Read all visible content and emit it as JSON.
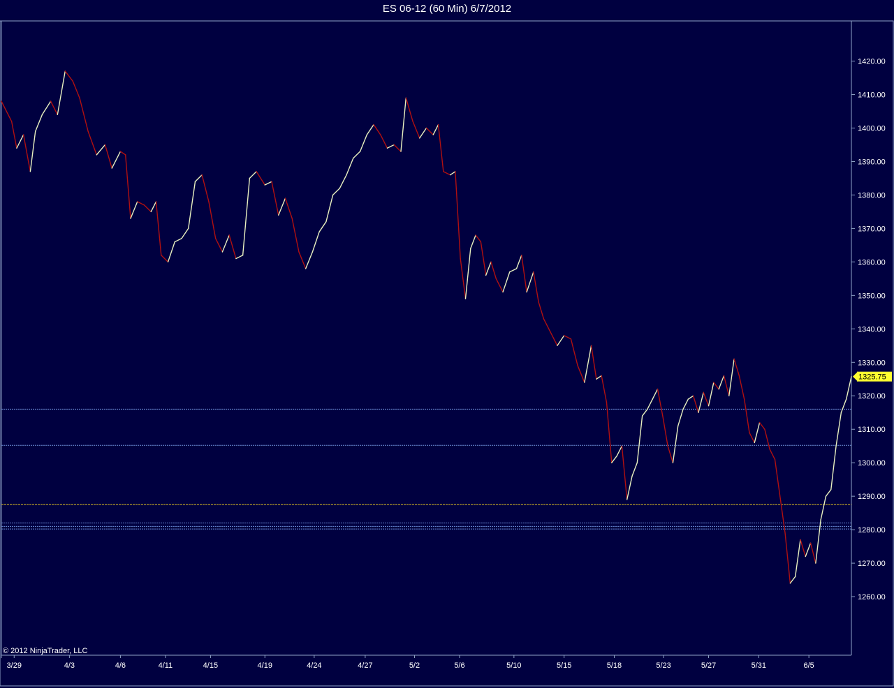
{
  "window": {
    "title": "ES 06-12 (60 Min)  6/7/2012"
  },
  "footer": {
    "copyright": "© 2012 NinjaTrader, LLC"
  },
  "colors": {
    "background": "#000040",
    "frame": "#8fa3c8",
    "text": "#ffffff",
    "up_line": "#e8f0c0",
    "down_line": "#b01010",
    "level_line_blue": "#6e8fd8",
    "level_line_yellow": "#e0c020",
    "price_marker": "#ffff30"
  },
  "chart_data": {
    "type": "line",
    "title": "ES 06-12 (60 Min)  6/7/2012",
    "instrument": "ES 06-12",
    "interval": "60 Min",
    "xlabel": "",
    "ylabel": "",
    "ylim": [
      1242.5,
      1432
    ],
    "y_ticks": [
      1420,
      1410,
      1400,
      1390,
      1380,
      1370,
      1360,
      1350,
      1340,
      1330,
      1320,
      1310,
      1300,
      1290,
      1280,
      1270,
      1260
    ],
    "y_tick_labels": [
      "1420.00",
      "1410.00",
      "1400.00",
      "1390.00",
      "1380.00",
      "1370.00",
      "1360.00",
      "1350.00",
      "1340.00",
      "1330.00",
      "1320.00",
      "1310.00",
      "1300.00",
      "1290.00",
      "1280.00",
      "1270.00",
      "1260.00"
    ],
    "x_ticks": [
      {
        "label": "3/29",
        "t": 0.015
      },
      {
        "label": "4/3",
        "t": 0.08
      },
      {
        "label": "4/6",
        "t": 0.14
      },
      {
        "label": "4/11",
        "t": 0.193
      },
      {
        "label": "4/15",
        "t": 0.246
      },
      {
        "label": "4/19",
        "t": 0.31
      },
      {
        "label": "4/24",
        "t": 0.368
      },
      {
        "label": "4/27",
        "t": 0.428
      },
      {
        "label": "5/2",
        "t": 0.486
      },
      {
        "label": "5/6",
        "t": 0.539
      },
      {
        "label": "5/10",
        "t": 0.603
      },
      {
        "label": "5/15",
        "t": 0.662
      },
      {
        "label": "5/18",
        "t": 0.721
      },
      {
        "label": "5/23",
        "t": 0.779
      },
      {
        "label": "5/27",
        "t": 0.832
      },
      {
        "label": "5/31",
        "t": 0.891
      },
      {
        "label": "6/5",
        "t": 0.95
      }
    ],
    "horizontal_levels": [
      {
        "value": 1316.0,
        "color": "#6e8fd8"
      },
      {
        "value": 1305.2,
        "color": "#6e8fd8"
      },
      {
        "value": 1287.5,
        "color": "#e0c020"
      },
      {
        "value": 1282.0,
        "color": "#6e8fd8"
      },
      {
        "value": 1281.0,
        "color": "#6e8fd8"
      },
      {
        "value": 1280.2,
        "color": "#6e8fd8"
      }
    ],
    "last_price": 1325.75,
    "last_price_label": "1325.75",
    "series": [
      {
        "values": [
          [
            0.0,
            1408
          ],
          [
            0.012,
            1402
          ],
          [
            0.018,
            1394
          ],
          [
            0.026,
            1398
          ],
          [
            0.034,
            1387
          ],
          [
            0.04,
            1399
          ],
          [
            0.048,
            1404
          ],
          [
            0.058,
            1408
          ],
          [
            0.066,
            1404
          ],
          [
            0.075,
            1417
          ],
          [
            0.084,
            1414
          ],
          [
            0.092,
            1409
          ],
          [
            0.102,
            1399
          ],
          [
            0.112,
            1392
          ],
          [
            0.122,
            1395
          ],
          [
            0.13,
            1388
          ],
          [
            0.14,
            1393
          ],
          [
            0.146,
            1392
          ],
          [
            0.152,
            1373
          ],
          [
            0.16,
            1378
          ],
          [
            0.168,
            1377
          ],
          [
            0.176,
            1375
          ],
          [
            0.182,
            1378
          ],
          [
            0.188,
            1362
          ],
          [
            0.196,
            1360
          ],
          [
            0.204,
            1366
          ],
          [
            0.212,
            1367
          ],
          [
            0.22,
            1370
          ],
          [
            0.228,
            1384
          ],
          [
            0.236,
            1386
          ],
          [
            0.244,
            1378
          ],
          [
            0.252,
            1367
          ],
          [
            0.26,
            1363
          ],
          [
            0.268,
            1368
          ],
          [
            0.276,
            1361
          ],
          [
            0.284,
            1362
          ],
          [
            0.292,
            1385
          ],
          [
            0.3,
            1387
          ],
          [
            0.31,
            1383
          ],
          [
            0.318,
            1384
          ],
          [
            0.326,
            1374
          ],
          [
            0.334,
            1379
          ],
          [
            0.342,
            1373
          ],
          [
            0.35,
            1363
          ],
          [
            0.358,
            1358
          ],
          [
            0.366,
            1363
          ],
          [
            0.374,
            1369
          ],
          [
            0.382,
            1372
          ],
          [
            0.39,
            1380
          ],
          [
            0.398,
            1382
          ],
          [
            0.406,
            1386
          ],
          [
            0.414,
            1391
          ],
          [
            0.422,
            1393
          ],
          [
            0.43,
            1398
          ],
          [
            0.438,
            1401
          ],
          [
            0.446,
            1398
          ],
          [
            0.454,
            1394
          ],
          [
            0.462,
            1395
          ],
          [
            0.47,
            1393
          ],
          [
            0.476,
            1409
          ],
          [
            0.484,
            1402
          ],
          [
            0.492,
            1397
          ],
          [
            0.5,
            1400
          ],
          [
            0.508,
            1398
          ],
          [
            0.514,
            1401
          ],
          [
            0.52,
            1387
          ],
          [
            0.528,
            1386
          ],
          [
            0.534,
            1387
          ],
          [
            0.54,
            1361
          ],
          [
            0.546,
            1349
          ],
          [
            0.552,
            1364
          ],
          [
            0.558,
            1368
          ],
          [
            0.564,
            1366
          ],
          [
            0.57,
            1356
          ],
          [
            0.576,
            1360
          ],
          [
            0.582,
            1355
          ],
          [
            0.59,
            1351
          ],
          [
            0.598,
            1357
          ],
          [
            0.606,
            1358
          ],
          [
            0.612,
            1362
          ],
          [
            0.618,
            1351
          ],
          [
            0.626,
            1357
          ],
          [
            0.632,
            1348
          ],
          [
            0.638,
            1343
          ],
          [
            0.646,
            1339
          ],
          [
            0.654,
            1335
          ],
          [
            0.662,
            1338
          ],
          [
            0.67,
            1337
          ],
          [
            0.678,
            1329
          ],
          [
            0.686,
            1324
          ],
          [
            0.694,
            1335
          ],
          [
            0.7,
            1325
          ],
          [
            0.706,
            1326
          ],
          [
            0.712,
            1318
          ],
          [
            0.718,
            1300
          ],
          [
            0.724,
            1302
          ],
          [
            0.73,
            1305
          ],
          [
            0.736,
            1289
          ],
          [
            0.742,
            1296
          ],
          [
            0.748,
            1300
          ],
          [
            0.754,
            1314
          ],
          [
            0.76,
            1316
          ],
          [
            0.766,
            1319
          ],
          [
            0.772,
            1322
          ],
          [
            0.778,
            1314
          ],
          [
            0.784,
            1305
          ],
          [
            0.79,
            1300
          ],
          [
            0.796,
            1311
          ],
          [
            0.802,
            1316
          ],
          [
            0.808,
            1319
          ],
          [
            0.814,
            1320
          ],
          [
            0.82,
            1315
          ],
          [
            0.826,
            1321
          ],
          [
            0.832,
            1317
          ],
          [
            0.838,
            1324
          ],
          [
            0.844,
            1322
          ],
          [
            0.85,
            1326
          ],
          [
            0.856,
            1320
          ],
          [
            0.862,
            1331
          ],
          [
            0.868,
            1326
          ],
          [
            0.874,
            1319
          ],
          [
            0.88,
            1309
          ],
          [
            0.886,
            1306
          ],
          [
            0.892,
            1312
          ],
          [
            0.898,
            1310
          ],
          [
            0.904,
            1304
          ],
          [
            0.91,
            1301
          ],
          [
            0.916,
            1290
          ],
          [
            0.922,
            1279
          ],
          [
            0.928,
            1264
          ],
          [
            0.934,
            1266
          ],
          [
            0.94,
            1277
          ],
          [
            0.946,
            1272
          ],
          [
            0.952,
            1276
          ],
          [
            0.958,
            1270
          ],
          [
            0.964,
            1283
          ],
          [
            0.97,
            1290
          ],
          [
            0.976,
            1292
          ],
          [
            0.982,
            1305
          ],
          [
            0.988,
            1315
          ],
          [
            0.994,
            1319
          ],
          [
            1.0,
            1325.75
          ]
        ]
      }
    ]
  }
}
